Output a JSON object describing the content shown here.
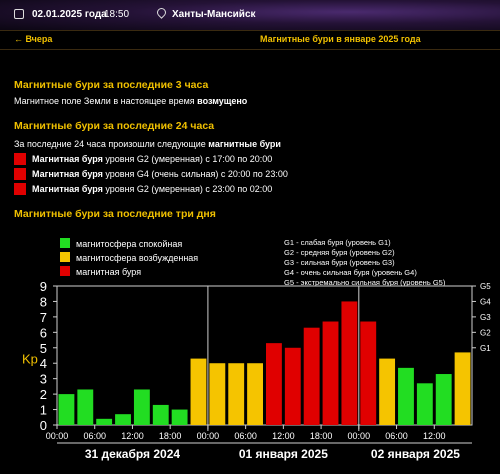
{
  "header": {
    "date": "02.01.2025 года",
    "time": "18:50",
    "city": "Ханты-Мансийск",
    "back_link": "← Вчера",
    "page_title": "Магнитные бури в январе 2025 года"
  },
  "section_3h": {
    "title": "Магнитные бури за последние 3 часа",
    "text_plain": "Магнитное поле Земли в настоящее время ",
    "text_bold": "возмущено"
  },
  "section_24h": {
    "title": "Магнитные бури за последние 24 часа",
    "text_plain": "За последние 24 часа произошли следующие ",
    "text_bold": "магнитные бури",
    "storms": [
      {
        "bold": "Магнитная буря",
        "rest": " уровня G2 (умеренная) с 17:00 по 20:00",
        "color": "#e00000"
      },
      {
        "bold": "Магнитная буря",
        "rest": " уровня G4 (очень сильная) с 20:00 по 23:00",
        "color": "#e00000"
      },
      {
        "bold": "Магнитная буря",
        "rest": " уровня G2 (умеренная) с 23:00 по 02:00",
        "color": "#e00000"
      }
    ]
  },
  "section_3d": {
    "title": "Магнитные бури за последние три дня"
  },
  "colors": {
    "calm": "#22dd22",
    "excited": "#f5c400",
    "storm": "#e00000",
    "accent": "#f0c000"
  },
  "chart_data": {
    "type": "bar",
    "ylabel": "Kp",
    "ylim": [
      0,
      9
    ],
    "yticks": [
      "0",
      "1",
      "2",
      "3",
      "4",
      "5",
      "6",
      "7",
      "8",
      "9"
    ],
    "right_ticks": [
      {
        "label": "G1",
        "value": 5
      },
      {
        "label": "G2",
        "value": 6
      },
      {
        "label": "G3",
        "value": 7
      },
      {
        "label": "G4",
        "value": 8
      },
      {
        "label": "G5",
        "value": 9
      }
    ],
    "xticks": [
      "00:00",
      "06:00",
      "12:00",
      "18:00",
      "00:00",
      "06:00",
      "12:00",
      "18:00",
      "00:00",
      "06:00",
      "12:00"
    ],
    "days": [
      "31 декабря 2024",
      "01 января 2025",
      "02 января 2025"
    ],
    "legend": [
      {
        "label": "магнитосфера спокойная",
        "color": "#22dd22"
      },
      {
        "label": "магнитосфера возбужденная",
        "color": "#f5c400"
      },
      {
        "label": "магнитная буря",
        "color": "#e00000"
      }
    ],
    "g_legend": [
      "G1 - слабая буря (уровень G1)",
      "G2 - средняя буря (уровень G2)",
      "G3 - сильная буря (уровень G3)",
      "G4 - очень сильная буря (уровень G4)",
      "G5 - экстремально сильная буря (уровень G5)"
    ],
    "values": [
      2.0,
      2.3,
      0.4,
      0.7,
      2.3,
      1.3,
      1.0,
      4.3,
      4.0,
      4.0,
      4.0,
      5.3,
      5.0,
      6.3,
      6.7,
      8.0,
      6.7,
      4.3,
      3.7,
      2.7,
      3.3,
      4.7
    ],
    "bar_colors": [
      "calm",
      "calm",
      "calm",
      "calm",
      "calm",
      "calm",
      "calm",
      "excited",
      "excited",
      "excited",
      "excited",
      "storm",
      "storm",
      "storm",
      "storm",
      "storm",
      "storm",
      "excited",
      "calm",
      "calm",
      "calm",
      "excited"
    ]
  }
}
